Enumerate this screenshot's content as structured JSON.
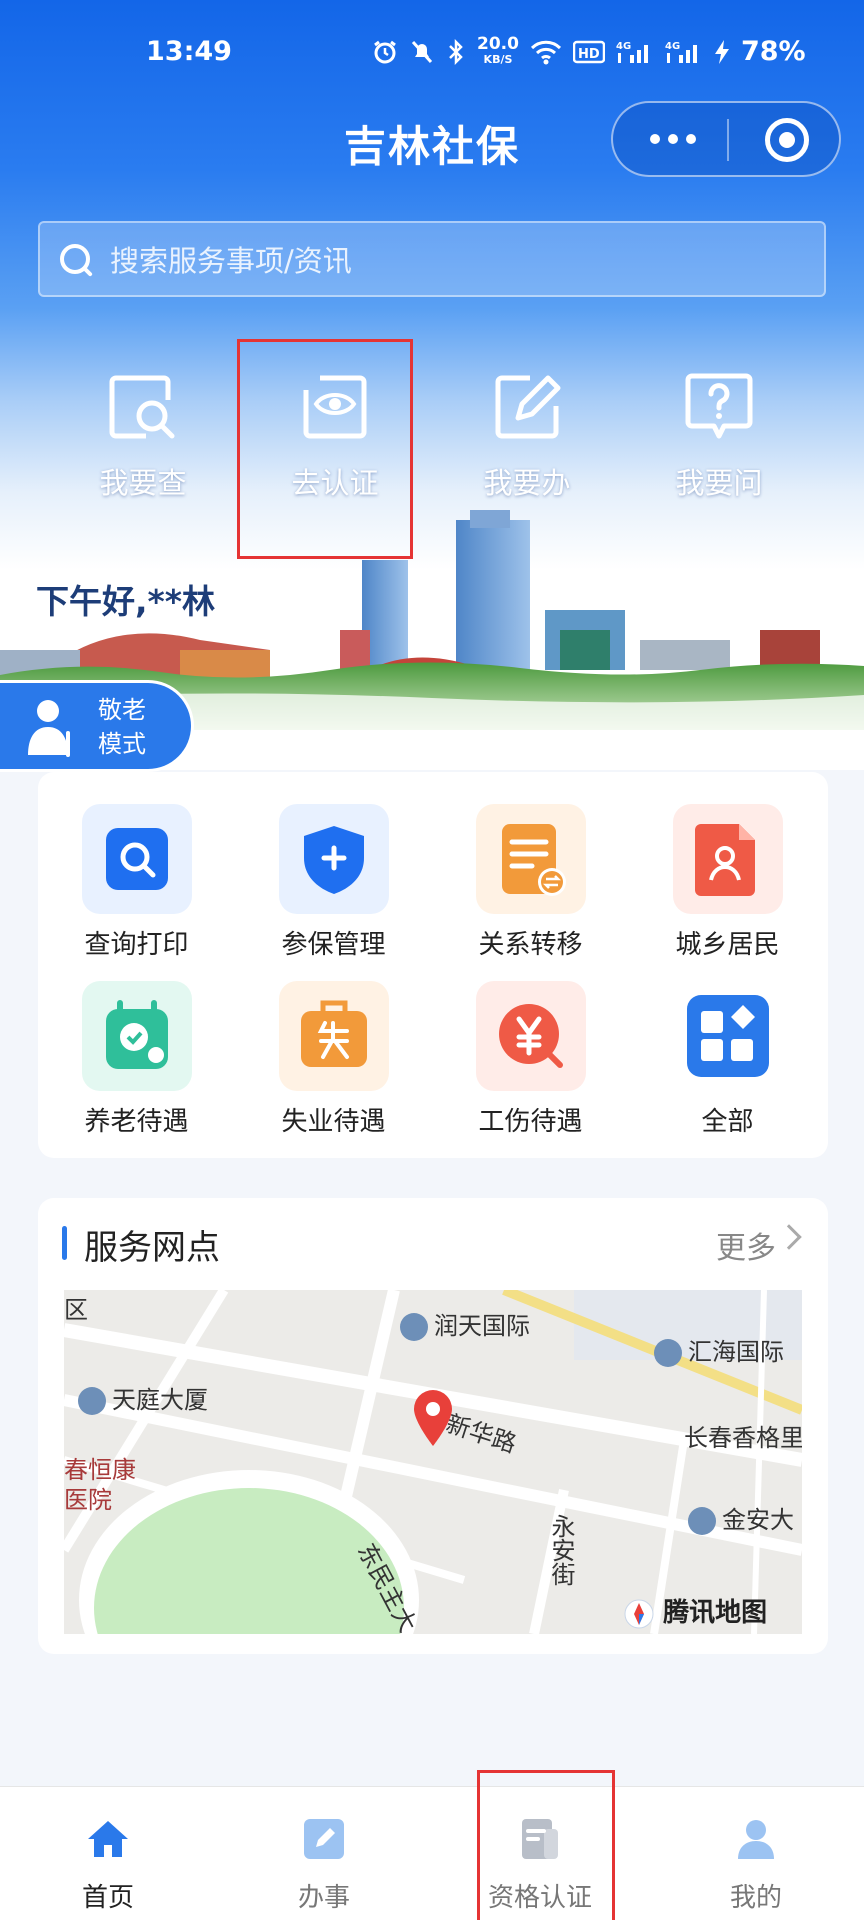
{
  "status_bar": {
    "time": "13:49",
    "speed": "20.0",
    "speed_unit": "KB/S",
    "battery": "78%"
  },
  "header": {
    "title": "吉林社保"
  },
  "search": {
    "placeholder": "搜索服务事项/资讯"
  },
  "quick_actions": [
    {
      "label": "我要查",
      "icon": "search-doc-icon"
    },
    {
      "label": "去认证",
      "icon": "eye-verify-icon"
    },
    {
      "label": "我要办",
      "icon": "edit-icon"
    },
    {
      "label": "我要问",
      "icon": "question-icon"
    }
  ],
  "greeting": "下午好,**林",
  "elder_mode": {
    "line1": "敬老",
    "line2": "模式"
  },
  "services": [
    {
      "label": "查询打印",
      "icon": "query-print-icon",
      "color": "#1f6ff0"
    },
    {
      "label": "参保管理",
      "icon": "shield-plus-icon",
      "color": "#1f6ff0"
    },
    {
      "label": "关系转移",
      "icon": "transfer-doc-icon",
      "color": "#f29a3a"
    },
    {
      "label": "城乡居民",
      "icon": "resident-doc-icon",
      "color": "#ef5a46"
    },
    {
      "label": "养老待遇",
      "icon": "pension-icon",
      "color": "#2fbf9a"
    },
    {
      "label": "失业待遇",
      "icon": "unemployment-icon",
      "color": "#f29a3a"
    },
    {
      "label": "工伤待遇",
      "icon": "injury-yen-icon",
      "color": "#ef5a46"
    },
    {
      "label": "全部",
      "icon": "all-apps-icon",
      "color": "#2a79ea"
    }
  ],
  "service_points": {
    "title": "服务网点",
    "more": "更多",
    "map_labels": {
      "runtian": "润天国际",
      "huihai": "汇海国际",
      "tianting": "天庭大厦",
      "xinhua": "新华路",
      "xiangge": "长春香格里",
      "jinan": "金安大",
      "hospital1": "春恒康",
      "hospital2": "医院",
      "dongminzhu": "东民主大",
      "yongan": "永安街",
      "district": "区",
      "brand": "腾讯地图"
    }
  },
  "tabbar": [
    {
      "label": "首页",
      "icon": "home-icon"
    },
    {
      "label": "办事",
      "icon": "pencil-icon"
    },
    {
      "label": "资格认证",
      "icon": "certificate-icon"
    },
    {
      "label": "我的",
      "icon": "user-icon"
    }
  ],
  "colors": {
    "brand_blue": "#1366e8",
    "highlight_red": "#e53434"
  }
}
